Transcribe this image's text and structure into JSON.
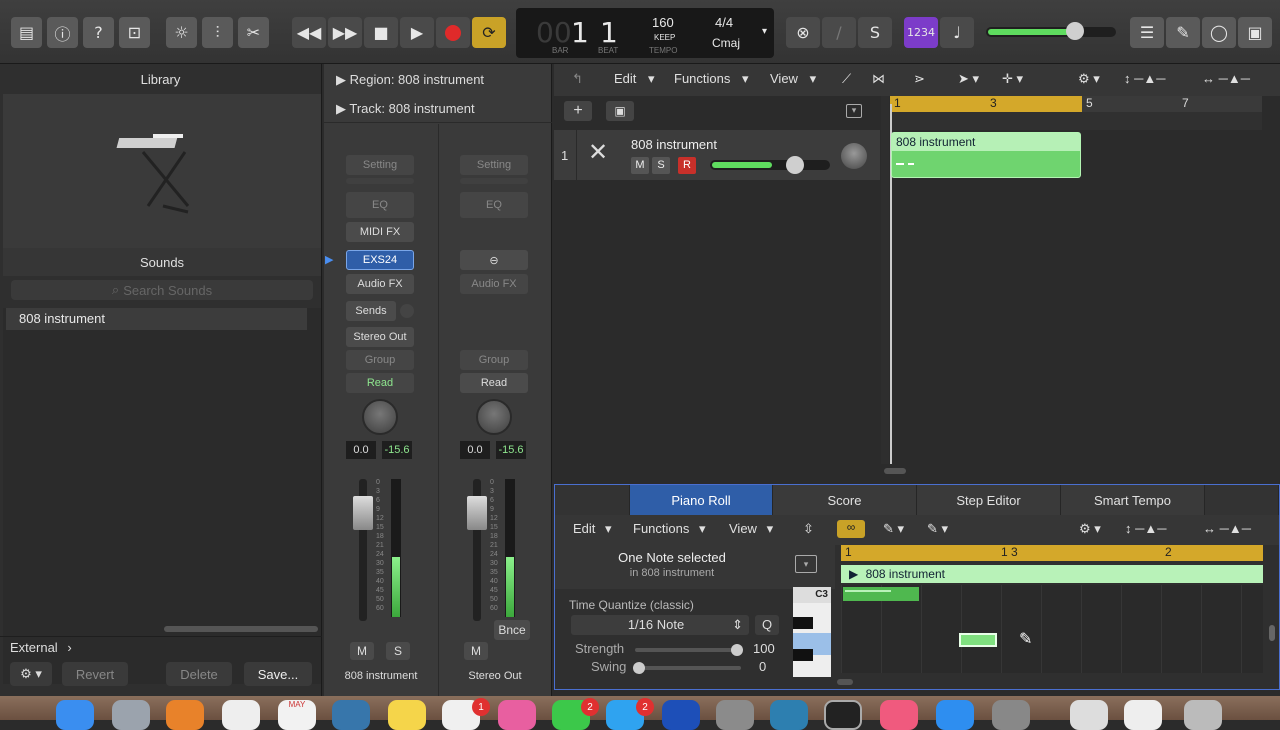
{
  "toolbar": {
    "lcd": {
      "bar_dim": "00",
      "bar": "1",
      "beat": "1",
      "bar_label": "BAR",
      "beat_label": "BEAT",
      "tempo": "160",
      "keep": "KEEP",
      "tempo_label": "TEMPO",
      "time_sig": "4/4",
      "key": "Cmaj"
    },
    "count_in": "1234",
    "colors": {
      "record": "#e02a2a",
      "cycle": "#c9a227",
      "accent": "#7c3cc9",
      "meter": "#5fdc5f"
    }
  },
  "library": {
    "title": "Library",
    "sounds_label": "Sounds",
    "search_placeholder": "Search Sounds",
    "items": [
      "808 instrument"
    ],
    "footer": {
      "external": "External",
      "chevron": "›",
      "revert": "Revert",
      "delete": "Delete",
      "save": "Save..."
    }
  },
  "inspector": {
    "region": "Region:  808 instrument",
    "track": "Track:  808 instrument",
    "strip1": {
      "setting": "Setting",
      "eq": "EQ",
      "midi_fx": "MIDI FX",
      "instrument": "EXS24",
      "audio_fx": "Audio FX",
      "sends": "Sends",
      "output": "Stereo Out",
      "group": "Group",
      "automation": "Read",
      "vol": "0.0",
      "peak": "-15.6",
      "mute": "M",
      "solo": "S",
      "name": "808 instrument"
    },
    "strip2": {
      "setting": "Setting",
      "eq": "EQ",
      "audio_fx": "Audio FX",
      "group": "Group",
      "automation": "Read",
      "vol": "0.0",
      "peak": "-15.6",
      "bounce": "Bnce",
      "mute": "M",
      "name": "Stereo Out"
    },
    "meter_scale": [
      "0",
      "3",
      "6",
      "9",
      "12",
      "15",
      "18",
      "21",
      "24",
      "30",
      "35",
      "40",
      "45",
      "50",
      "60"
    ]
  },
  "tracks": {
    "menus": {
      "edit": "Edit",
      "functions": "Functions",
      "view": "View"
    },
    "ruler": [
      "1",
      "3",
      "5",
      "7"
    ],
    "track": {
      "number": "1",
      "name": "808 instrument",
      "mute": "M",
      "solo": "S",
      "record": "R"
    },
    "region_name": "808 instrument"
  },
  "piano_roll": {
    "tabs": [
      "Piano Roll",
      "Score",
      "Step Editor",
      "Smart Tempo"
    ],
    "menus": {
      "edit": "Edit",
      "functions": "Functions",
      "view": "View"
    },
    "selection": "One Note selected",
    "selection_sub": "in 808 instrument",
    "quantize_label": "Time Quantize (classic)",
    "quantize_value": "1/16 Note",
    "q": "Q",
    "strength_label": "Strength",
    "strength_value": "100",
    "swing_label": "Swing",
    "swing_value": "0",
    "ruler": [
      "1",
      "1 3",
      "2"
    ],
    "region_name": "808 instrument",
    "key_label": "C3"
  },
  "dock": {
    "badges": [
      "1",
      "2",
      "2"
    ],
    "date": "MAY"
  }
}
